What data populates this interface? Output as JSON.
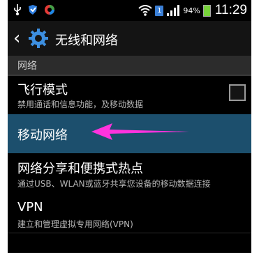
{
  "status_bar": {
    "icons_left": [
      "usb-icon",
      "shield-icon",
      "colorful-app-icon"
    ],
    "sim_label": "1",
    "battery_percent": "94%",
    "time": "11:29"
  },
  "action_bar": {
    "title": "无线和网络"
  },
  "section": {
    "label": "网络"
  },
  "items": [
    {
      "title": "飞行模式",
      "desc": "禁用通话和信息功能，及移动数据",
      "checked": false
    },
    {
      "title": "移动网络"
    },
    {
      "title": "网络分享和便携式热点",
      "desc": "通过USB、WLAN或蓝牙共享您设备的移动数据连接"
    },
    {
      "title": "VPN",
      "desc": "建立和管理虚拟专用网络(VPN)"
    }
  ],
  "colors": {
    "selected_row": "#1c4f6d",
    "arrow": "#ff33dd"
  }
}
